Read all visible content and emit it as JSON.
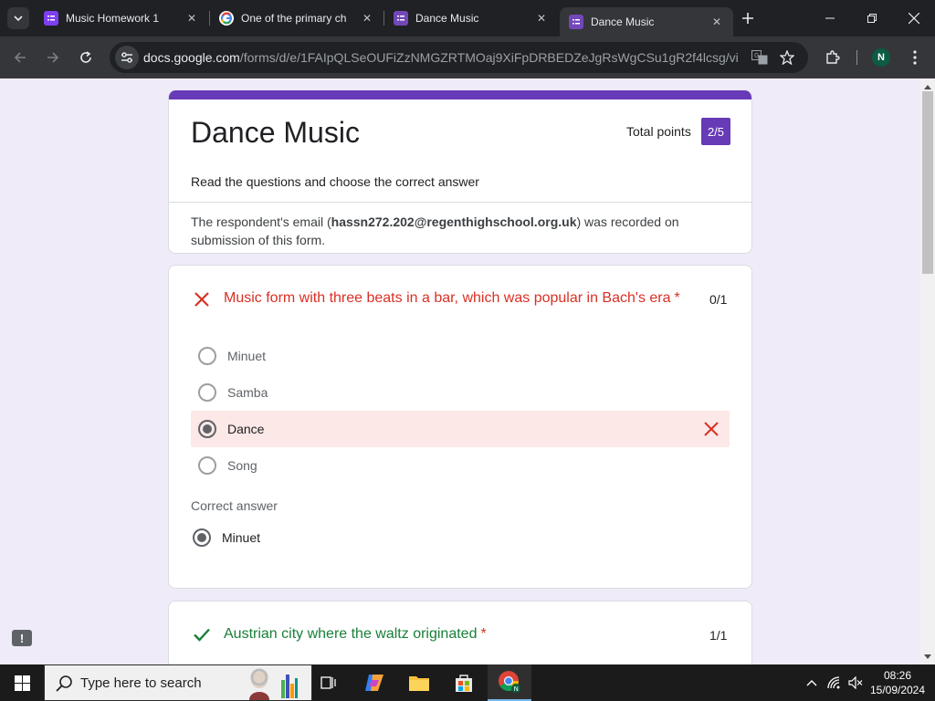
{
  "browser": {
    "tabs": [
      {
        "title": "Music Homework 1",
        "favicon": "google-forms-icon",
        "color": "#7e3ff2"
      },
      {
        "title": "One of the primary ch",
        "favicon": "google-g-icon",
        "color": "#ffffff"
      },
      {
        "title": "Dance Music",
        "favicon": "google-forms-icon",
        "color": "#7248b9"
      },
      {
        "title": "Dance Music",
        "favicon": "google-forms-icon",
        "color": "#7248b9",
        "active": true
      }
    ],
    "url_domain": "docs.google.com",
    "url_path": "/forms/d/e/1FAIpQLSeOUFiZzNMGZRTMOaj9XiFpDRBEDZeJgRsWgCSu1gR2f4lcsg/views...",
    "profile_initial": "N"
  },
  "form": {
    "title": "Dance Music",
    "total_points_label": "Total points",
    "total_points_value": "2/5",
    "description": "Read the questions and choose the correct answer",
    "email_prefix": "The respondent's email (",
    "email": "hassn272.202@regenthighschool.org.uk",
    "email_suffix": ") was recorded on submission of this form.",
    "accent_color": "#673ab7"
  },
  "questions": [
    {
      "text": "Music form with three beats in a bar, which was popular in Bach's era",
      "required_mark": "*",
      "score": "0/1",
      "status": "incorrect",
      "options": [
        {
          "label": "Minuet",
          "selected": false
        },
        {
          "label": "Samba",
          "selected": false
        },
        {
          "label": "Dance",
          "selected": true,
          "marked_wrong": true
        },
        {
          "label": "Song",
          "selected": false
        }
      ],
      "correct_answer_header": "Correct answer",
      "correct_answer": "Minuet"
    },
    {
      "text": "Austrian city where the waltz originated",
      "required_mark": "*",
      "score": "1/1",
      "status": "correct"
    }
  ],
  "taskbar": {
    "search_placeholder": "Type here to search",
    "time": "08:26",
    "date": "15/09/2024"
  }
}
